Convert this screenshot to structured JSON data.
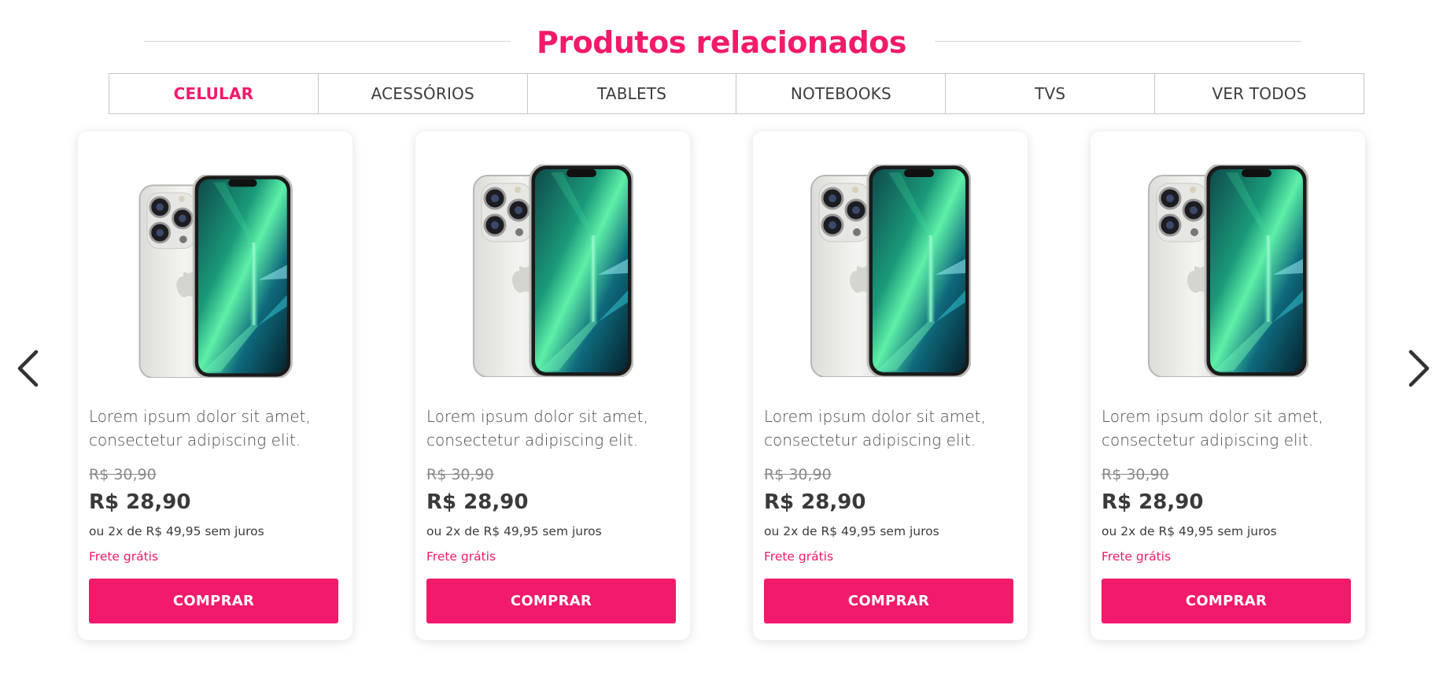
{
  "section": {
    "title": "Produtos relacionados"
  },
  "tabs": [
    {
      "label": "CELULAR",
      "active": true
    },
    {
      "label": "ACESSÓRIOS",
      "active": false
    },
    {
      "label": "TABLETS",
      "active": false
    },
    {
      "label": "NOTEBOOKS",
      "active": false
    },
    {
      "label": "TVS",
      "active": false
    },
    {
      "label": "VER TODOS",
      "active": false
    }
  ],
  "carousel": {
    "prev_icon": "chevron-left-icon",
    "next_icon": "chevron-right-icon"
  },
  "products": [
    {
      "name": "Lorem ipsum dolor sit amet, consectetur adipiscing elit.",
      "old_price": "R$ 30,90",
      "price": "R$ 28,90",
      "installments": "ou 2x de R$ 49,95 sem juros",
      "shipping": "Frete grátis",
      "buy_label": "COMPRAR",
      "image": "smartphone-image"
    },
    {
      "name": "Lorem ipsum dolor sit amet, consectetur adipiscing elit.",
      "old_price": "R$ 30,90",
      "price": "R$ 28,90",
      "installments": "ou 2x de R$ 49,95 sem juros",
      "shipping": "Frete grátis",
      "buy_label": "COMPRAR",
      "image": "smartphone-image"
    },
    {
      "name": "Lorem ipsum dolor sit amet, consectetur adipiscing elit.",
      "old_price": "R$ 30,90",
      "price": "R$ 28,90",
      "installments": "ou 2x de R$ 49,95 sem juros",
      "shipping": "Frete grátis",
      "buy_label": "COMPRAR",
      "image": "smartphone-image"
    },
    {
      "name": "Lorem ipsum dolor sit amet, consectetur adipiscing elit.",
      "old_price": "R$ 30,90",
      "price": "R$ 28,90",
      "installments": "ou 2x de R$ 49,95 sem juros",
      "shipping": "Frete grátis",
      "buy_label": "COMPRAR",
      "image": "smartphone-image"
    }
  ],
  "colors": {
    "accent": "#f21a6a",
    "text": "#3b3b3b",
    "muted": "#8a8a8a"
  }
}
